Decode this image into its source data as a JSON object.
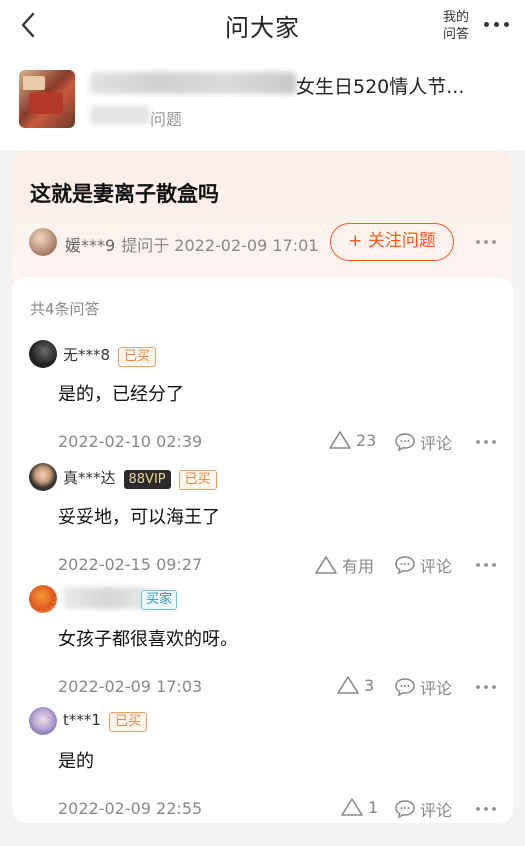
{
  "header": {
    "title": "问大家",
    "my_qa_line1": "我的",
    "my_qa_line2": "问答"
  },
  "product": {
    "title_visible": "女生日520情人节...",
    "subtitle_visible": "问题"
  },
  "question": {
    "text": "这就是妻离子散盒吗",
    "asker": "媛***9",
    "asked_at": "提问于 2022-02-09 17:01",
    "follow_label": "+ 关注问题"
  },
  "answers_header": "共4条问答",
  "answers": [
    {
      "user": "无***8",
      "badge": "已买",
      "text": "是的，已经分了",
      "date": "2022-02-10 02:39",
      "vote": "23",
      "comment": "评论"
    },
    {
      "user": "真***达",
      "vip": "88VIP",
      "badge": "已买",
      "text": "妥妥地，可以海王了",
      "date": "2022-02-15 09:27",
      "vote": "有用",
      "comment": "评论"
    },
    {
      "badge": "买家",
      "text": "女孩子都很喜欢的呀。",
      "date": "2022-02-09 17:03",
      "vote": "3",
      "comment": "评论"
    },
    {
      "user": "t***1",
      "badge": "已买",
      "text": "是的",
      "date": "2022-02-09 22:55",
      "vote": "1",
      "comment": "评论"
    }
  ],
  "icons": [
    "back-arrow-icon",
    "more-icon",
    "thumb-up-triangle-icon",
    "comment-bubble-icon"
  ],
  "colors": {
    "accent": "#ff5a1f",
    "bought_badge": "#e8833a",
    "vip_bg": "#2b2b2b",
    "question_bg": "#fdeee9"
  }
}
